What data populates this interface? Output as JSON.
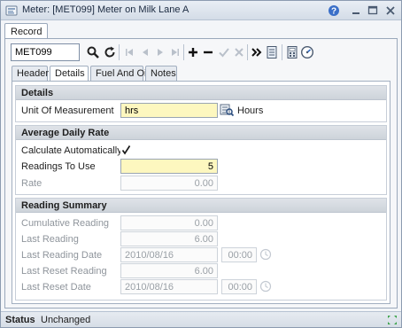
{
  "window": {
    "title": "Meter: [MET099] Meter on Milk Lane A"
  },
  "record_tab": {
    "label": "Record"
  },
  "toolbar": {
    "code_value": "MET099"
  },
  "tabs": [
    {
      "label": "Header",
      "active": false
    },
    {
      "label": "Details",
      "active": true
    },
    {
      "label": "Fuel And Oil",
      "active": false
    },
    {
      "label": "Notes",
      "active": false
    }
  ],
  "details": {
    "header": "Details",
    "unit_label": "Unit Of Measurement",
    "unit_value": "hrs",
    "unit_desc": "Hours"
  },
  "average": {
    "header": "Average Daily Rate",
    "calc_label": "Calculate Automatically",
    "calc_checked": true,
    "readings_label": "Readings To Use",
    "readings_value": "5",
    "rate_label": "Rate",
    "rate_value": "0.00"
  },
  "summary": {
    "header": "Reading Summary",
    "cumulative_label": "Cumulative Reading",
    "cumulative_value": "0.00",
    "last_reading_label": "Last Reading",
    "last_reading_value": "6.00",
    "last_date_label": "Last Reading Date",
    "last_date_value": "2010/08/16",
    "last_time_value": "00:00",
    "reset_reading_label": "Last Reset Reading",
    "reset_reading_value": "6.00",
    "reset_date_label": "Last Reset Date",
    "reset_date_value": "2010/08/16",
    "reset_time_value": "00:00"
  },
  "status": {
    "label": "Status",
    "value": "Unchanged"
  }
}
